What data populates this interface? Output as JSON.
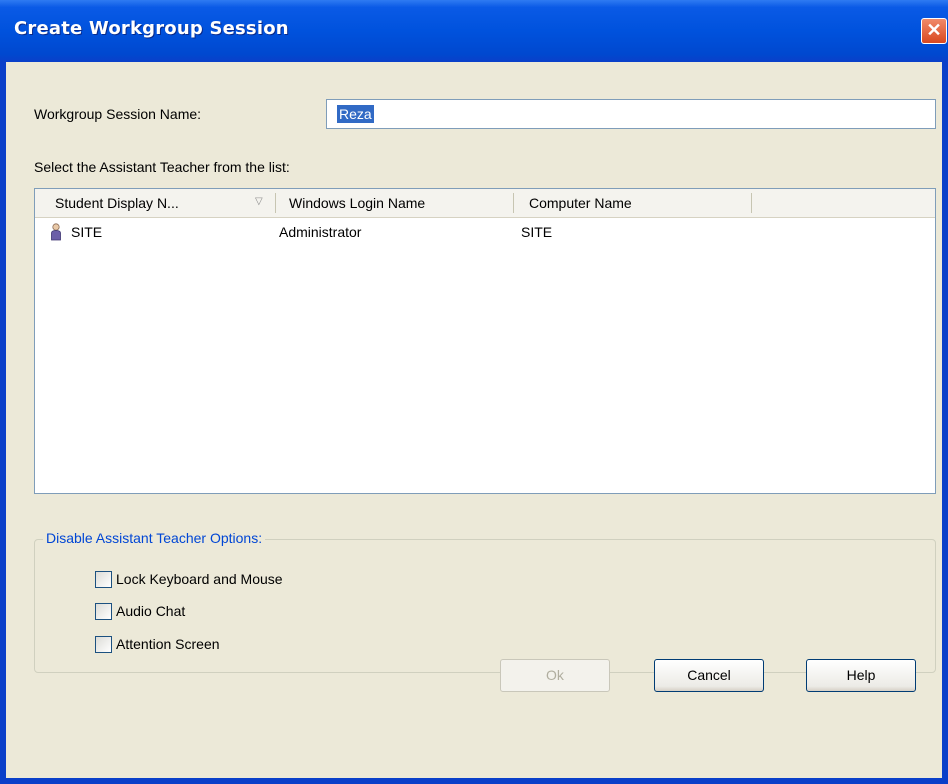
{
  "window": {
    "title": "Create Workgroup Session",
    "close_glyph": "✕"
  },
  "session_name": {
    "label": "Workgroup Session Name:",
    "value": "Reza"
  },
  "assistant_list": {
    "label": "Select the Assistant Teacher from the list:",
    "columns": [
      "Student Display N...",
      "Windows Login Name",
      "Computer Name"
    ],
    "sort_indicator": "▽",
    "rows": [
      {
        "icon": "user-icon",
        "display_name": "SITE",
        "login_name": "Administrator",
        "computer_name": "SITE"
      }
    ]
  },
  "options": {
    "title": "Disable Assistant Teacher Options:",
    "items": [
      {
        "label": "Lock Keyboard and Mouse",
        "checked": false
      },
      {
        "label": "Audio Chat",
        "checked": false
      },
      {
        "label": "Attention Screen",
        "checked": false
      }
    ]
  },
  "buttons": {
    "ok": "Ok",
    "cancel": "Cancel",
    "help": "Help"
  },
  "colors": {
    "title_bar": "#0052dd",
    "group_title": "#0046d5",
    "selection": "#316ac5"
  }
}
